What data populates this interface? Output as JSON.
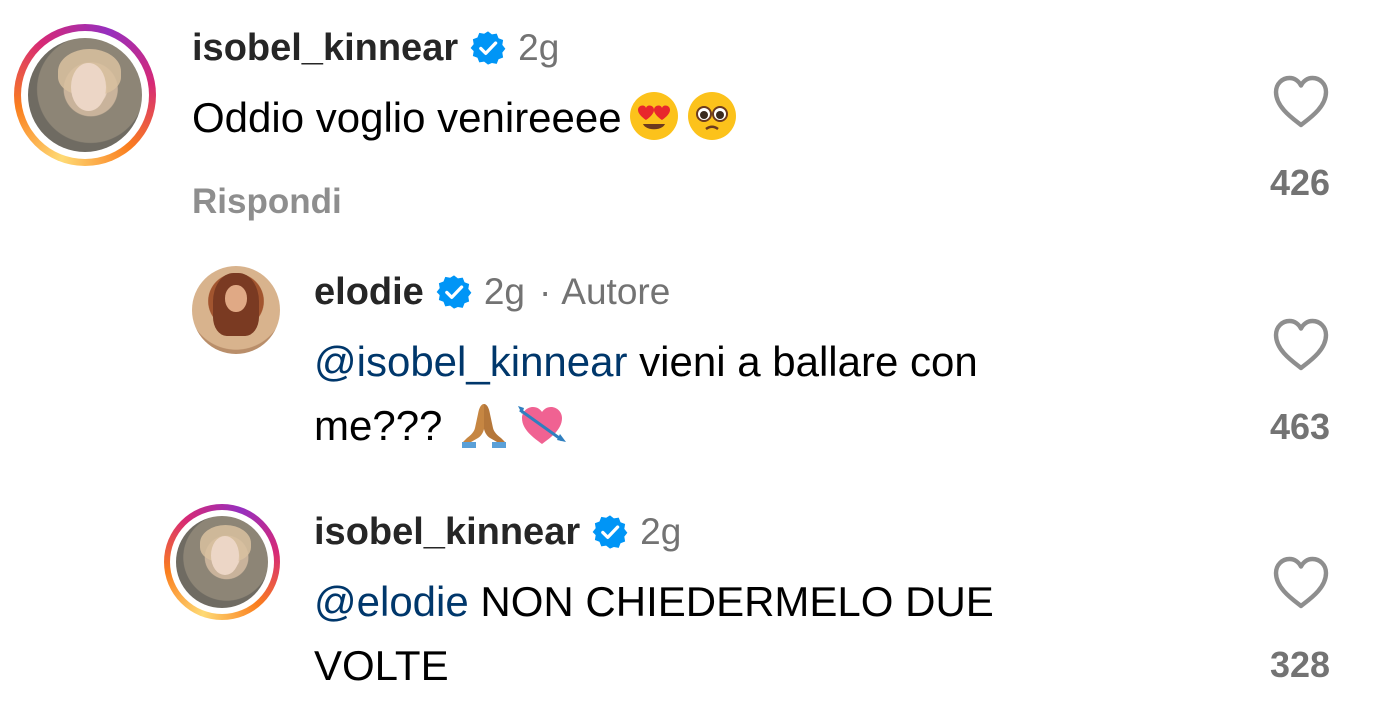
{
  "comments": [
    {
      "username": "isobel_kinnear",
      "verified_icon": "verified-badge-icon",
      "time": "2g",
      "text": "Oddio voglio venireeee",
      "emojis": [
        "heart-eyes-emoji",
        "pleading-face-emoji"
      ],
      "reply_label": "Rispondi",
      "likes": "426",
      "has_story_ring": true
    },
    {
      "username": "elodie",
      "verified_icon": "verified-badge-icon",
      "time": "2g",
      "separator": "·",
      "author_badge": "Autore",
      "mention": "@isobel_kinnear",
      "text_line1": " vieni a ballare con",
      "text_line2": "me???",
      "emojis": [
        "folded-hands-emoji",
        "heart-with-arrow-emoji"
      ],
      "likes": "463",
      "has_story_ring": false
    },
    {
      "username": "isobel_kinnear",
      "verified_icon": "verified-badge-icon",
      "time": "2g",
      "mention": "@elodie",
      "text_line1": " NON CHIEDERMELO DUE",
      "text_line2": "VOLTE",
      "likes": "328",
      "has_story_ring": true
    }
  ],
  "colors": {
    "mention": "#00376b",
    "verified": "#0095f6",
    "muted": "#737373"
  }
}
